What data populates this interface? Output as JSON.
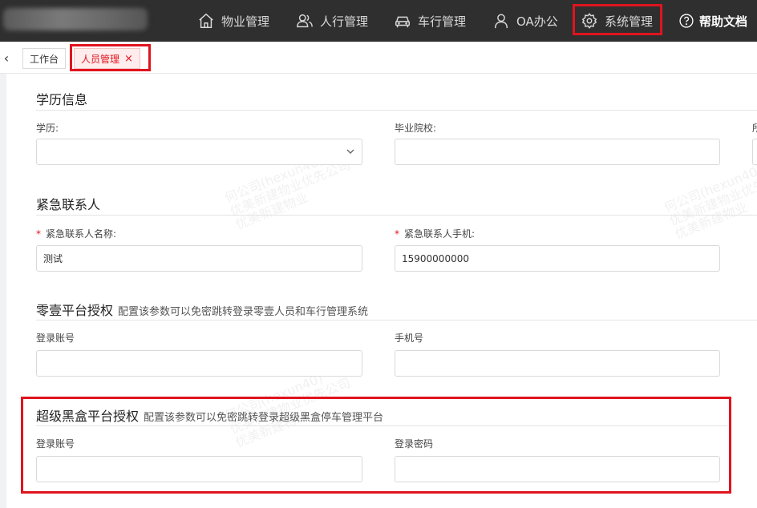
{
  "topnav": {
    "items": [
      {
        "label": "物业管理",
        "icon": "home-icon"
      },
      {
        "label": "人行管理",
        "icon": "users-icon"
      },
      {
        "label": "车行管理",
        "icon": "car-icon"
      },
      {
        "label": "OA办公",
        "icon": "person-icon"
      },
      {
        "label": "系统管理",
        "icon": "gear-icon"
      }
    ],
    "help": {
      "label": "帮助文档",
      "icon": "question-circle-icon"
    }
  },
  "tabs": {
    "back": "‹",
    "items": [
      {
        "label": "工作台"
      },
      {
        "label": "人员管理",
        "close": "×"
      }
    ]
  },
  "education": {
    "title": "学历信息",
    "degree_label": "学历:",
    "degree_value": "",
    "school_label": "毕业院校:",
    "school_value": "",
    "third_label": "所"
  },
  "emergency": {
    "title": "紧急联系人",
    "required_mark": "*",
    "name_label": "紧急联系人名称:",
    "name_value": "测试",
    "phone_label": "紧急联系人手机:",
    "phone_value": "15900000000"
  },
  "lingyi": {
    "title": "零壹平台授权",
    "subtitle": "配置该参数可以免密跳转登录零壹人员和车行管理系统",
    "account_label": "登录账号",
    "account_value": "",
    "phone_label": "手机号",
    "phone_value": ""
  },
  "blackbox": {
    "title": "超级黑盒平台授权",
    "subtitle": "配置该参数可以免密跳转登录超级黑盒停车管理平台",
    "account_label": "登录账号",
    "account_value": "",
    "password_label": "登录密码",
    "password_value": ""
  },
  "watermark": {
    "line1": "何公司(hexun40)",
    "line2": "优美新建物业优先公司",
    "line3": "优美新建物业"
  }
}
